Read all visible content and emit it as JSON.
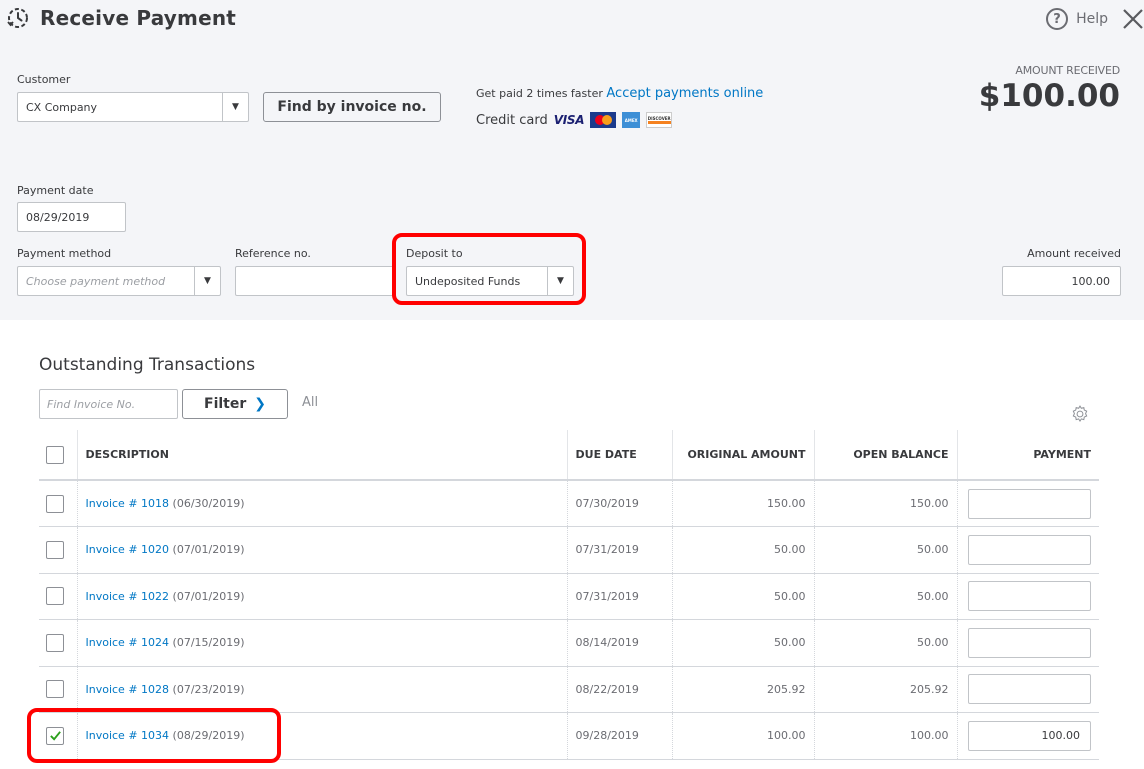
{
  "header": {
    "title": "Receive Payment",
    "title_icon": "receive-payment-clock-icon",
    "help_label": "Help",
    "help_icon": "question-circle-icon",
    "close_icon": "close-icon"
  },
  "customer": {
    "label": "Customer",
    "value": "CX Company",
    "find_button": "Find by invoice no."
  },
  "promo": {
    "text": "Get paid 2 times faster",
    "link": "Accept payments online",
    "credit_card_label": "Credit card",
    "cards": [
      "VISA",
      "MasterCard",
      "American Express",
      "Discover"
    ]
  },
  "amount_summary": {
    "label": "AMOUNT RECEIVED",
    "value": "$100.00"
  },
  "payment_date": {
    "label": "Payment date",
    "value": "08/29/2019"
  },
  "payment_method": {
    "label": "Payment method",
    "placeholder": "Choose payment method"
  },
  "reference": {
    "label": "Reference no.",
    "value": ""
  },
  "deposit_to": {
    "label": "Deposit to",
    "value": "Undeposited Funds"
  },
  "amount_received": {
    "label": "Amount received",
    "value": "100.00"
  },
  "outstanding": {
    "title": "Outstanding Transactions",
    "find_placeholder": "Find Invoice No.",
    "filter_label": "Filter",
    "all_label": "All",
    "settings_icon": "gear-icon",
    "columns": {
      "description": "DESCRIPTION",
      "due_date": "DUE DATE",
      "original_amount": "ORIGINAL AMOUNT",
      "open_balance": "OPEN BALANCE",
      "payment": "PAYMENT"
    },
    "rows": [
      {
        "invoice": "Invoice # 1018",
        "date": "(06/30/2019)",
        "due_date": "07/30/2019",
        "original": "150.00",
        "open": "150.00",
        "payment": "",
        "checked": false
      },
      {
        "invoice": "Invoice # 1020",
        "date": "(07/01/2019)",
        "due_date": "07/31/2019",
        "original": "50.00",
        "open": "50.00",
        "payment": "",
        "checked": false
      },
      {
        "invoice": "Invoice # 1022",
        "date": "(07/01/2019)",
        "due_date": "07/31/2019",
        "original": "50.00",
        "open": "50.00",
        "payment": "",
        "checked": false
      },
      {
        "invoice": "Invoice # 1024",
        "date": "(07/15/2019)",
        "due_date": "08/14/2019",
        "original": "50.00",
        "open": "50.00",
        "payment": "",
        "checked": false
      },
      {
        "invoice": "Invoice # 1028",
        "date": "(07/23/2019)",
        "due_date": "08/22/2019",
        "original": "205.92",
        "open": "205.92",
        "payment": "",
        "checked": false
      },
      {
        "invoice": "Invoice # 1034",
        "date": "(08/29/2019)",
        "due_date": "09/28/2019",
        "original": "100.00",
        "open": "100.00",
        "payment": "100.00",
        "checked": true
      }
    ]
  },
  "colors": {
    "accent_link": "#0077c5",
    "highlight_red": "#ff0000",
    "check_green": "#2ca01c",
    "panel_bg": "#f4f5f8"
  }
}
